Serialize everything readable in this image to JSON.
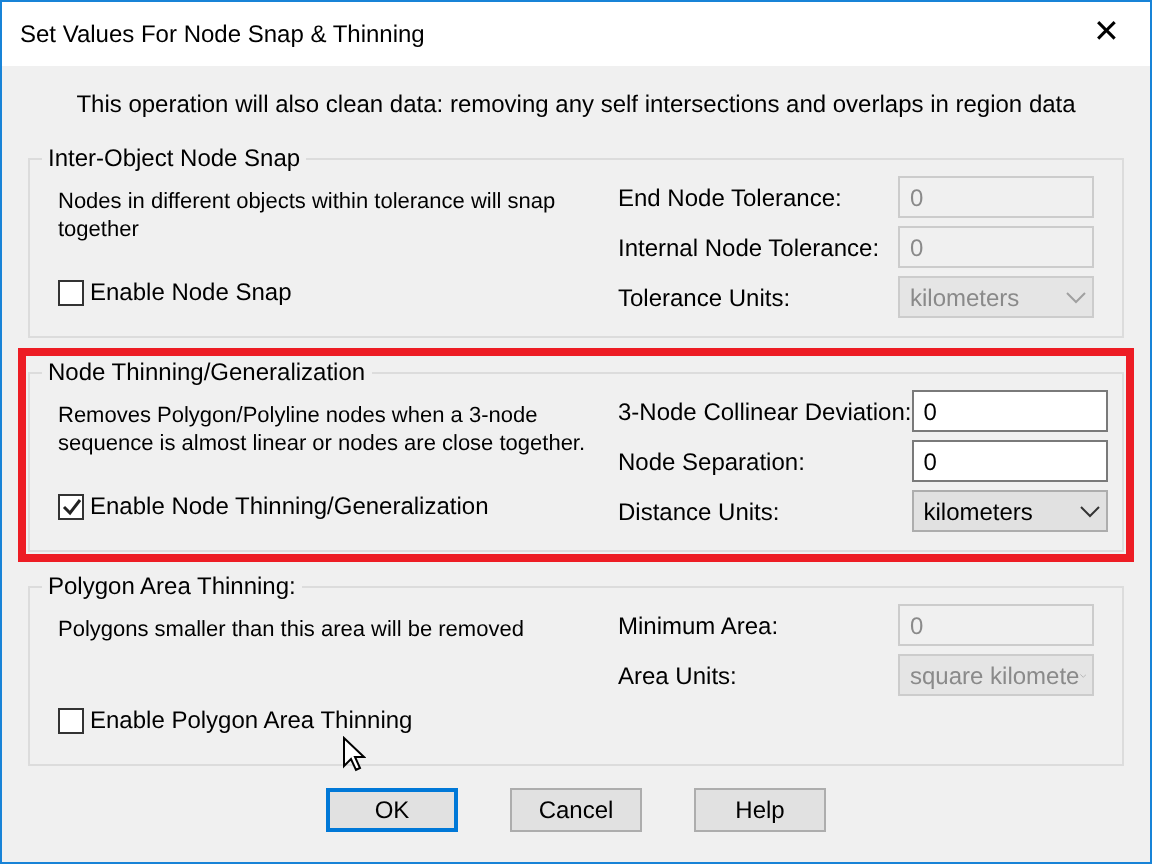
{
  "window": {
    "title": "Set Values For Node Snap & Thinning",
    "close": "✕"
  },
  "note": "This operation will also clean data: removing any self intersections and overlaps in region data",
  "groups": [
    {
      "title": "Inter-Object Node Snap",
      "highlighted": false,
      "description": "Nodes in different objects within tolerance will snap together",
      "checkbox": {
        "label": "Enable Node Snap",
        "checked": false
      },
      "fields": [
        {
          "kind": "input",
          "label": "End Node Tolerance:",
          "value": "0",
          "disabled": true
        },
        {
          "kind": "input",
          "label": "Internal Node Tolerance:",
          "value": "0",
          "disabled": true
        },
        {
          "kind": "dropdown",
          "label": "Tolerance Units:",
          "value": "kilometers",
          "disabled": true
        }
      ]
    },
    {
      "title": "Node Thinning/Generalization",
      "highlighted": true,
      "description": "Removes Polygon/Polyline nodes when a 3-node sequence is almost linear or nodes are close together.",
      "checkbox": {
        "label": "Enable Node Thinning/Generalization",
        "checked": true
      },
      "fields": [
        {
          "kind": "input",
          "label": "3-Node Collinear Deviation:",
          "value": "0",
          "disabled": false
        },
        {
          "kind": "input",
          "label": "Node Separation:",
          "value": "0",
          "disabled": false
        },
        {
          "kind": "dropdown",
          "label": "Distance Units:",
          "value": "kilometers",
          "disabled": false
        }
      ]
    },
    {
      "title": "Polygon Area Thinning:",
      "highlighted": false,
      "description": "Polygons smaller than this area will be removed",
      "checkbox": {
        "label": "Enable Polygon Area Thinning",
        "checked": false
      },
      "fields": [
        {
          "kind": "input",
          "label": "Minimum Area:",
          "value": "0",
          "disabled": true
        },
        {
          "kind": "dropdown",
          "label": "Area Units:",
          "value": "square kilomete",
          "disabled": true
        }
      ]
    }
  ],
  "buttons": [
    {
      "label": "OK",
      "default": true
    },
    {
      "label": "Cancel",
      "default": false
    },
    {
      "label": "Help",
      "default": false
    }
  ]
}
